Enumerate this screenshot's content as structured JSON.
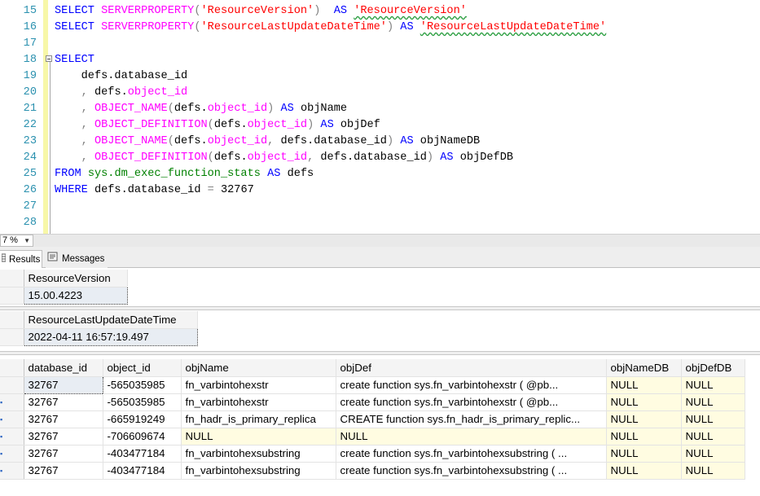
{
  "editor": {
    "lines": [
      {
        "n": "15",
        "tokens": [
          [
            "kw",
            "SELECT"
          ],
          [
            "nm",
            " "
          ],
          [
            "fn",
            "SERVERPROPERTY"
          ],
          [
            "op",
            "("
          ],
          [
            "str",
            "'ResourceVersion'"
          ],
          [
            "op",
            ")"
          ],
          [
            "nm",
            "  "
          ],
          [
            "kw",
            "AS"
          ],
          [
            "nm",
            " "
          ],
          [
            "str sq",
            "'ResourceVersion'"
          ]
        ]
      },
      {
        "n": "16",
        "tokens": [
          [
            "kw",
            "SELECT"
          ],
          [
            "nm",
            " "
          ],
          [
            "fn",
            "SERVERPROPERTY"
          ],
          [
            "op",
            "("
          ],
          [
            "str",
            "'ResourceLastUpdateDateTime'"
          ],
          [
            "op",
            ")"
          ],
          [
            "nm",
            " "
          ],
          [
            "kw",
            "AS"
          ],
          [
            "nm",
            " "
          ],
          [
            "str sq",
            "'ResourceLastUpdateDateTime'"
          ]
        ]
      },
      {
        "n": "17",
        "tokens": []
      },
      {
        "n": "18",
        "tokens": [
          [
            "kw",
            "SELECT"
          ]
        ]
      },
      {
        "n": "19",
        "tokens": [
          [
            "nm",
            "    defs.database_id"
          ]
        ]
      },
      {
        "n": "20",
        "tokens": [
          [
            "nm",
            "    "
          ],
          [
            "op",
            ","
          ],
          [
            "nm",
            " defs."
          ],
          [
            "fn",
            "object_id"
          ]
        ]
      },
      {
        "n": "21",
        "tokens": [
          [
            "nm",
            "    "
          ],
          [
            "op",
            ","
          ],
          [
            "nm",
            " "
          ],
          [
            "fn",
            "OBJECT_NAME"
          ],
          [
            "op",
            "("
          ],
          [
            "nm",
            "defs."
          ],
          [
            "fn",
            "object_id"
          ],
          [
            "op",
            ")"
          ],
          [
            "nm",
            " "
          ],
          [
            "kw",
            "AS"
          ],
          [
            "nm",
            " objName"
          ]
        ]
      },
      {
        "n": "22",
        "tokens": [
          [
            "nm",
            "    "
          ],
          [
            "op",
            ","
          ],
          [
            "nm",
            " "
          ],
          [
            "fn",
            "OBJECT_DEFINITION"
          ],
          [
            "op",
            "("
          ],
          [
            "nm",
            "defs."
          ],
          [
            "fn",
            "object_id"
          ],
          [
            "op",
            ")"
          ],
          [
            "nm",
            " "
          ],
          [
            "kw",
            "AS"
          ],
          [
            "nm",
            " objDef"
          ]
        ]
      },
      {
        "n": "23",
        "tokens": [
          [
            "nm",
            "    "
          ],
          [
            "op",
            ","
          ],
          [
            "nm",
            " "
          ],
          [
            "fn",
            "OBJECT_NAME"
          ],
          [
            "op",
            "("
          ],
          [
            "nm",
            "defs."
          ],
          [
            "fn",
            "object_id"
          ],
          [
            "op",
            ","
          ],
          [
            "nm",
            " defs.database_id"
          ],
          [
            "op",
            ")"
          ],
          [
            "nm",
            " "
          ],
          [
            "kw",
            "AS"
          ],
          [
            "nm",
            " objNameDB"
          ]
        ]
      },
      {
        "n": "24",
        "tokens": [
          [
            "nm",
            "    "
          ],
          [
            "op",
            ","
          ],
          [
            "nm",
            " "
          ],
          [
            "fn",
            "OBJECT_DEFINITION"
          ],
          [
            "op",
            "("
          ],
          [
            "nm",
            "defs."
          ],
          [
            "fn",
            "object_id"
          ],
          [
            "op",
            ","
          ],
          [
            "nm",
            " defs.database_id"
          ],
          [
            "op",
            ")"
          ],
          [
            "nm",
            " "
          ],
          [
            "kw",
            "AS"
          ],
          [
            "nm",
            " objDefDB"
          ]
        ]
      },
      {
        "n": "25",
        "tokens": [
          [
            "kw",
            "FROM"
          ],
          [
            "nm",
            " "
          ],
          [
            "sys",
            "sys.dm_exec_function_stats"
          ],
          [
            "nm",
            " "
          ],
          [
            "kw",
            "AS"
          ],
          [
            "nm",
            " defs"
          ]
        ]
      },
      {
        "n": "26",
        "tokens": [
          [
            "kw",
            "WHERE"
          ],
          [
            "nm",
            " defs.database_id "
          ],
          [
            "op",
            "="
          ],
          [
            "nm",
            " 32767"
          ]
        ]
      },
      {
        "n": "27",
        "tokens": []
      },
      {
        "n": "28",
        "tokens": []
      }
    ]
  },
  "zoom": {
    "value": "7 %"
  },
  "tabs": {
    "results": "Results",
    "messages": "Messages"
  },
  "result1": {
    "header": "ResourceVersion",
    "value": "15.00.4223"
  },
  "result2": {
    "header": "ResourceLastUpdateDateTime",
    "value": "2022-04-11 16:57:19.497"
  },
  "result3": {
    "columns": [
      "database_id",
      "object_id",
      "objName",
      "objDef",
      "objNameDB",
      "objDefDB"
    ],
    "rows": [
      [
        "32767",
        "-565035985",
        "fn_varbintohexstr",
        "create function sys.fn_varbintohexstr   (      @pb...",
        "NULL",
        "NULL"
      ],
      [
        "32767",
        "-565035985",
        "fn_varbintohexstr",
        "create function sys.fn_varbintohexstr   (      @pb...",
        "NULL",
        "NULL"
      ],
      [
        "32767",
        "-665919249",
        "fn_hadr_is_primary_replica",
        "CREATE function sys.fn_hadr_is_primary_replic...",
        "NULL",
        "NULL"
      ],
      [
        "32767",
        "-706609674",
        "NULL",
        "NULL",
        "NULL",
        "NULL"
      ],
      [
        "32767",
        "-403477184",
        "fn_varbintohexsubstring",
        "create function sys.fn_varbintohexsubstring (    ...",
        "NULL",
        "NULL"
      ],
      [
        "32767",
        "-403477184",
        "fn_varbintohexsubstring",
        "create function sys.fn_varbintohexsubstring (    ...",
        "NULL",
        "NULL"
      ]
    ]
  },
  "colors": {
    "keyword": "#0000ff",
    "function": "#ff00ff",
    "string": "#ff0000",
    "system": "#008000",
    "line_number": "#2b91af",
    "null_cell": "#fffce1"
  }
}
